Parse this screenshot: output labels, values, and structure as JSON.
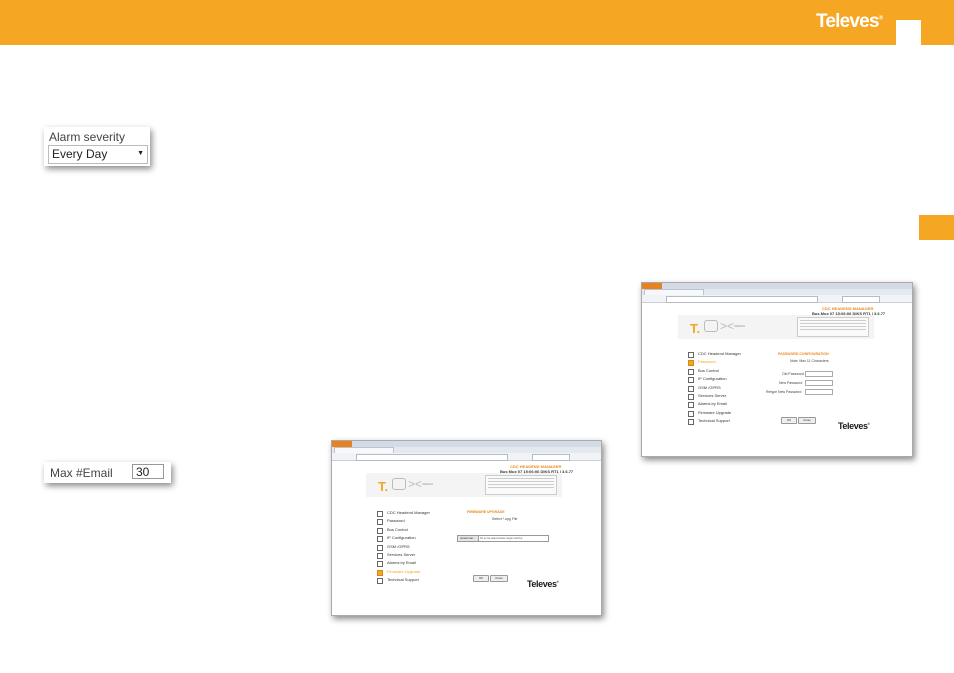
{
  "header": {
    "brand": "Televes",
    "brand_mark": "®"
  },
  "alarm_snippet": {
    "label": "Alarm severity",
    "value": "Every Day"
  },
  "email_snippet": {
    "label": "Max #Email",
    "value": "30"
  },
  "password_screen": {
    "header_title": "CDC HEADEND MANAGER",
    "header_sub": "Bus Mux 07 15:06:06 DIKS RT1 | 3.6.77",
    "banner_logo": "T.",
    "banner_series": "SERIES",
    "menu": [
      {
        "label": "CDC Headend Manager",
        "selected": false
      },
      {
        "label": "Password",
        "selected": true
      },
      {
        "label": "Bus Control",
        "selected": false
      },
      {
        "label": "IP Configuration",
        "selected": false
      },
      {
        "label": "GSM /GPRS",
        "selected": false
      },
      {
        "label": "Services Server",
        "selected": false
      },
      {
        "label": "Alarms by Email",
        "selected": false
      },
      {
        "label": "Firmware Upgrade",
        "selected": false
      },
      {
        "label": "Technical Support",
        "selected": false
      }
    ],
    "section_title": "PASSWORD CONFIGURATION",
    "note": "Note: Max 11 Characters",
    "fields": [
      "Old Password",
      "New Password",
      "Retype New Password"
    ],
    "ok": "OK",
    "close": "Close",
    "brand": "Televes"
  },
  "firmware_screen": {
    "header_title": "CDC HEADEND MANAGER",
    "header_sub": "Bus Mux 07 15:06:06 DIKS RT1 | 3.6.77",
    "banner_logo": "T.",
    "banner_series": "SERIES",
    "menu": [
      {
        "label": "CDC Headend Manager",
        "selected": false
      },
      {
        "label": "Password",
        "selected": false
      },
      {
        "label": "Bus Control",
        "selected": false
      },
      {
        "label": "IP Configuration",
        "selected": false
      },
      {
        "label": "GSM /GPRS",
        "selected": false
      },
      {
        "label": "Services Server",
        "selected": false
      },
      {
        "label": "Alarms by Email",
        "selected": false
      },
      {
        "label": "Firmware Upgrade",
        "selected": true
      },
      {
        "label": "Technical Support",
        "selected": false
      }
    ],
    "section_title": "FIRMWARE UPGRADE",
    "select_label": "Select *.upg File",
    "browse": "Examinar...",
    "file_text": "No se ha seleccionado ningún archivo",
    "ok": "OK",
    "close": "Close",
    "brand": "Televes"
  }
}
